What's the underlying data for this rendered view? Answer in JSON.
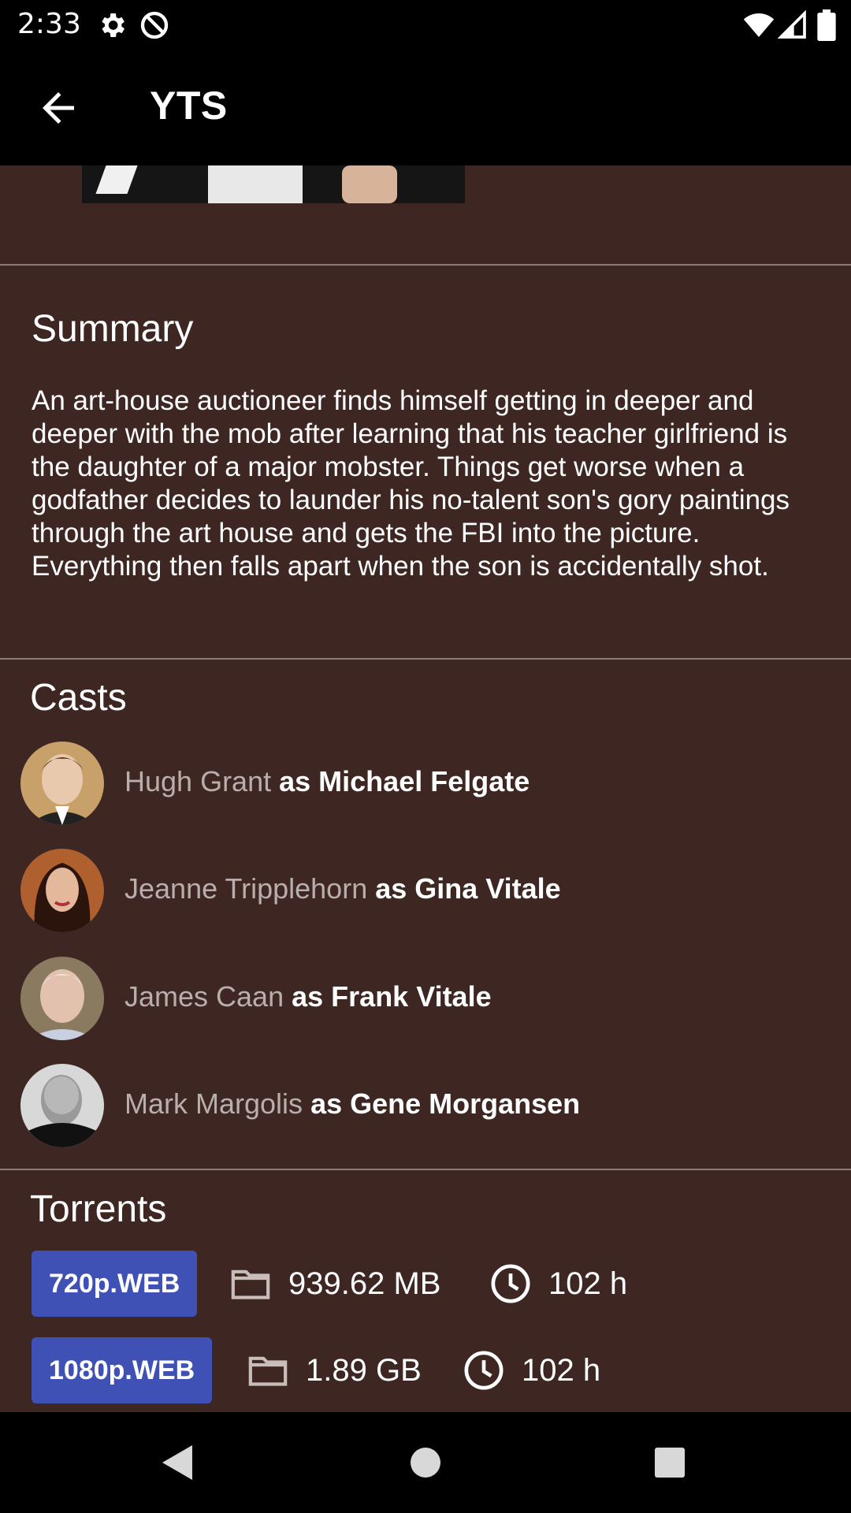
{
  "status_bar": {
    "time": "2:33",
    "icons": [
      "gear-icon",
      "at-sign-icon",
      "wifi-icon",
      "signal-icon",
      "battery-icon"
    ]
  },
  "app_bar": {
    "title": "YTS",
    "back_icon": "arrow-left-icon"
  },
  "summary": {
    "title": "Summary",
    "text": "An art-house auctioneer finds himself getting in deeper and deeper with the mob after learning that his teacher girlfriend is the daughter of a major mobster. Things get worse when a godfather decides to launder his no-talent son's gory paintings through the art house and gets the FBI into the picture. Everything then falls apart when the son is accidentally shot."
  },
  "casts": {
    "title": "Casts",
    "items": [
      {
        "actor": "Hugh Grant",
        "role": "as Michael Felgate",
        "avatar_color": "#b8875a"
      },
      {
        "actor": "Jeanne Tripplehorn",
        "role": "as Gina Vitale",
        "avatar_color": "#8a4a2e"
      },
      {
        "actor": "James Caan",
        "role": "as Frank Vitale",
        "avatar_color": "#a08a74"
      },
      {
        "actor": "Mark Margolis",
        "role": "as Gene Morgansen",
        "avatar_color": "#7a7a7a"
      }
    ]
  },
  "torrents": {
    "title": "Torrents",
    "items": [
      {
        "quality": "720p.WEB",
        "size": "939.62 MB",
        "duration": "102 h"
      },
      {
        "quality": "1080p.WEB",
        "size": "1.89 GB",
        "duration": "102 h"
      }
    ]
  },
  "colors": {
    "background": "#3e2723",
    "accent": "#3f51b5",
    "bar": "#000000"
  }
}
